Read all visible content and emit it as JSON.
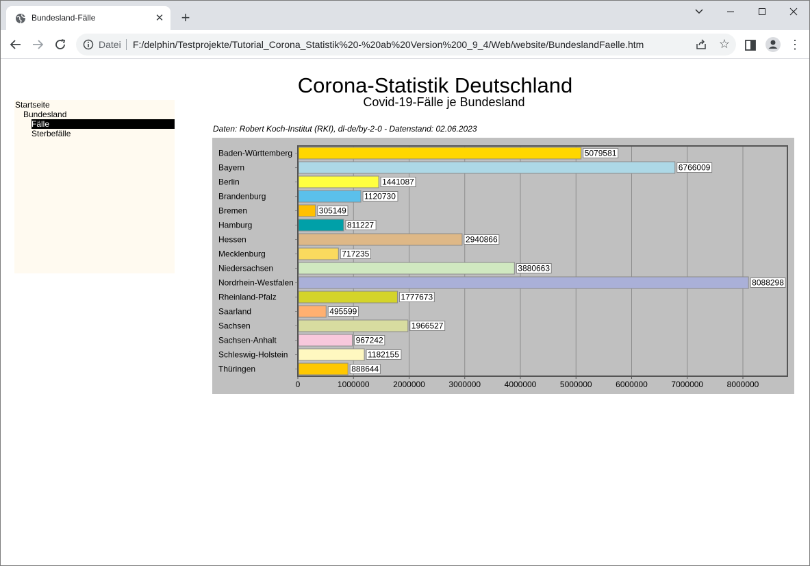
{
  "browser": {
    "tab_title": "Bundesland-Fälle",
    "scheme_label": "Datei",
    "url": "F:/delphin/Testprojekte/Tutorial_Corona_Statistik%20-%20ab%20Version%200_9_4/Web/website/BundeslandFaelle.htm"
  },
  "nav": {
    "items": [
      {
        "label": "Startseite"
      },
      {
        "label": "Bundesland"
      },
      {
        "label": "Fälle"
      },
      {
        "label": "Sterbefälle"
      }
    ]
  },
  "page": {
    "title": "Corona-Statistik Deutschland",
    "subtitle": "Covid-19-Fälle je Bundesland",
    "source": "Daten: Robert Koch-Institut (RKI), dl-de/by-2-0 - Datenstand: 02.06.2023"
  },
  "chart_data": {
    "type": "bar",
    "orientation": "horizontal",
    "title": "",
    "xlabel": "",
    "ylabel": "",
    "categories": [
      "Baden-Württemberg",
      "Bayern",
      "Berlin",
      "Brandenburg",
      "Bremen",
      "Hamburg",
      "Hessen",
      "Mecklenburg",
      "Niedersachsen",
      "Nordrhein-Westfalen",
      "Rheinland-Pfalz",
      "Saarland",
      "Sachsen",
      "Sachsen-Anhalt",
      "Schleswig-Holstein",
      "Thüringen"
    ],
    "values": [
      5079581,
      6766009,
      1441087,
      1120730,
      305149,
      811227,
      2940866,
      717235,
      3880663,
      8088298,
      1777673,
      495599,
      1966527,
      967242,
      1182155,
      888644
    ],
    "colors": [
      "#ffd700",
      "#add8e6",
      "#ffff40",
      "#5bc0eb",
      "#ffc000",
      "#00a0a8",
      "#deb887",
      "#fada5e",
      "#d0e8c0",
      "#aab0d8",
      "#d4d42a",
      "#ffb070",
      "#d8dca0",
      "#f8c8dc",
      "#fff8c0",
      "#ffc800"
    ],
    "xlim": [
      0,
      8800000
    ],
    "xticks": [
      0,
      1000000,
      2000000,
      3000000,
      4000000,
      5000000,
      6000000,
      7000000,
      8000000
    ],
    "xtick_labels": [
      "0",
      "1000000",
      "2000000",
      "3000000",
      "4000000",
      "5000000",
      "6000000",
      "7000000",
      "8000000"
    ],
    "grid": "vertical",
    "background": "#c0c0c0",
    "data_labels": true
  }
}
